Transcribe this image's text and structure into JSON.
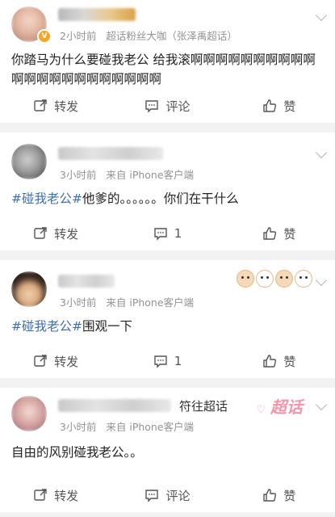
{
  "posts": [
    {
      "time": "2小时前",
      "source": "超话粉丝大咖（张泽禹超话）",
      "text": "你踏马为什么要碰我老公 给我滚啊啊啊啊啊啊啊啊啊啊啊啊啊啊啊啊啊啊啊啊啊啊",
      "actions": {
        "repost": "转发",
        "comment": "评论",
        "like": "赞"
      }
    },
    {
      "time": "3小时前",
      "source": "来自 iPhone客户端",
      "tag": "#碰我老公#",
      "text": "他爹的。。。。。。你们在干什么",
      "actions": {
        "repost": "转发",
        "comment": "1",
        "like": "赞"
      }
    },
    {
      "time": "3小时前",
      "source": "来自 iPhone客户端",
      "tag": "#碰我老公#",
      "text": "围观一下",
      "actions": {
        "repost": "转发",
        "comment": "1",
        "like": "赞"
      }
    },
    {
      "time": "3小时前",
      "source": "来自 iPhone客户端",
      "name_suffix": "符往超话",
      "watermark": "超话",
      "text": "自由的风别碰我老公。。",
      "actions": {
        "repost": "转发",
        "comment": "评论",
        "like": "赞"
      }
    }
  ],
  "colors": {
    "topic_blue": "#3d6fb6",
    "vip_gold": "#f5a623",
    "watermark_pink": "#f37a96"
  }
}
